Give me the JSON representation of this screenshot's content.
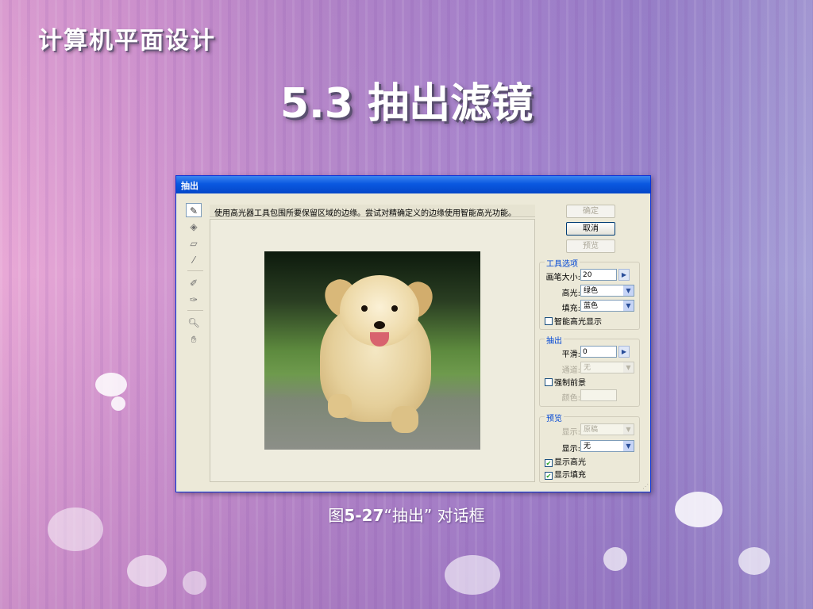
{
  "slide": {
    "brand": "计算机平面设计",
    "title": "5.3 抽出滤镜",
    "caption": {
      "prefix": "图",
      "number": "5-27",
      "rest": "“抽出” 对话框"
    }
  },
  "dialog": {
    "title": "抽出",
    "hint": "使用高光器工具包围所要保留区域的边缘。尝试对精确定义的边缘使用智能高光功能。",
    "tools": [
      "highlighter-icon",
      "fill-icon",
      "eraser-icon",
      "eyedropper-icon",
      "cleanup-icon",
      "edge-touchup-icon",
      "zoom-icon",
      "hand-icon"
    ],
    "buttons": {
      "ok": "确定",
      "cancel": "取消",
      "preview": "预览"
    },
    "tool_options": {
      "title": "工具选项",
      "brush_size_label": "画笔大小:",
      "brush_size": "20",
      "highlight_label": "高光:",
      "highlight_value": "绿色",
      "fill_label": "填充:",
      "fill_value": "蓝色",
      "smart_highlight_label": "智能高光显示"
    },
    "extraction": {
      "title": "抽出",
      "smooth_label": "平滑:",
      "smooth_value": "0",
      "channel_label": "通道:",
      "channel_value": "无",
      "force_foreground_label": "强制前景",
      "color_label": "颜色:"
    },
    "preview": {
      "title": "预览",
      "show_label_1": "显示:",
      "show_value_1": "原稿",
      "show_label_2": "显示:",
      "show_value_2": "无",
      "show_highlight_label": "显示高光",
      "show_fill_label": "显示填充"
    }
  }
}
